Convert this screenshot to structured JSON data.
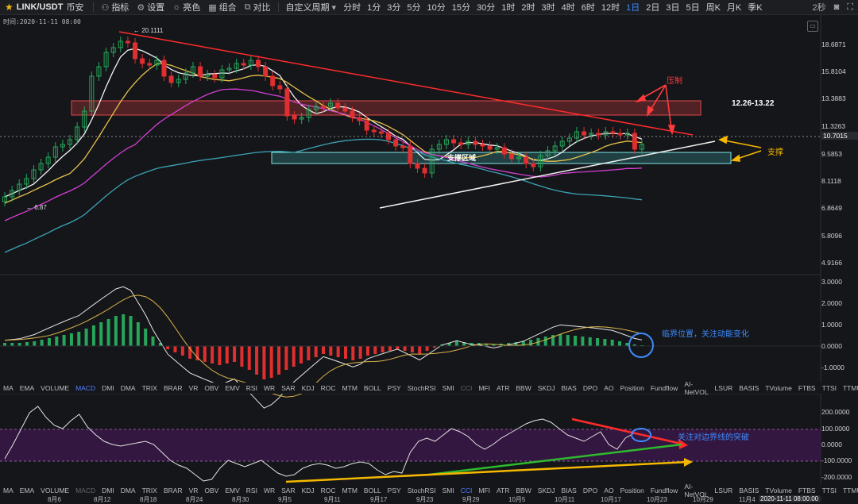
{
  "toolbar": {
    "symbol": "LINK/USDT",
    "exchange": "币安",
    "buttons": [
      {
        "icon": "indicator-icon",
        "label": "指标"
      },
      {
        "icon": "gear-icon",
        "label": "设置"
      },
      {
        "icon": "brightness-icon",
        "label": "亮色"
      },
      {
        "icon": "combine-icon",
        "label": "组合"
      },
      {
        "icon": "compare-icon",
        "label": "对比"
      }
    ],
    "custom_period": "自定义周期",
    "periods": [
      "分时",
      "1分",
      "3分",
      "5分",
      "10分",
      "15分",
      "30分",
      "1时",
      "2时",
      "3时",
      "4时",
      "6时",
      "12时",
      "1日",
      "2日",
      "3日",
      "5日",
      "周K",
      "月K",
      "季K"
    ],
    "active_period": "1日",
    "refresh": "2秒"
  },
  "time_label": "时间:2020-11-11 08:00",
  "main_chart": {
    "price_axis": [
      "18.6871",
      "15.8104",
      "13.3883",
      "11.3263",
      "9.5853",
      "8.1118",
      "6.8649",
      "5.8096",
      "4.9166"
    ],
    "current_price": "10.7015",
    "high_label": "← 20.1111",
    "low_label": "← 6.87",
    "zone_label_right": "12.26-13.22",
    "support_zone_label": "支撑区域",
    "resistance_note": "压制",
    "support_note": "支撑"
  },
  "macd_panel": {
    "axis": [
      "3.0000",
      "2.0000",
      "1.0000",
      "0.0000",
      "-1.0000"
    ],
    "note": "临界位置，关注动能变化"
  },
  "cci_panel": {
    "axis": [
      "200.0000",
      "100.0000",
      "0.0000",
      "-100.0000",
      "-200.0000"
    ],
    "note": "关注对边界线的突破"
  },
  "indicator_tabs": [
    "MA",
    "EMA",
    "VOLUME",
    "MACD",
    "DMI",
    "DMA",
    "TRIX",
    "BRAR",
    "VR",
    "OBV",
    "EMV",
    "RSI",
    "WR",
    "SAR",
    "KDJ",
    "ROC",
    "MTM",
    "BOLL",
    "PSY",
    "StochRSI",
    "SMI",
    "CCI",
    "MFI",
    "ATR",
    "BBW",
    "SKDJ",
    "BIAS",
    "DPO",
    "AO",
    "Position",
    "Fundflow",
    "AI-NetVOL",
    "LSUR",
    "BASIS",
    "TVolume",
    "FTBS",
    "TTSI",
    "TTMU"
  ],
  "indicator_tabs_row1_active": "MACD",
  "indicator_tabs_row2_active": "CCI",
  "date_axis": [
    "8月6",
    "8月12",
    "8月18",
    "8月24",
    "8月30",
    "9月5",
    "9月11",
    "9月17",
    "9月23",
    "9月29",
    "10月5",
    "10月11",
    "10月17",
    "10月23",
    "10月29",
    "11月4"
  ],
  "date_current": "2020-11-11 08:00:00",
  "colors": {
    "up": "#26a65b",
    "down": "#e02f2f",
    "accent": "#3d8bfd",
    "zone_red": "#c0393b",
    "zone_cyan": "#4fd6d6",
    "note_red": "#ff3b3b",
    "note_yellow": "#f5b800",
    "note_blue": "#3d8bfd"
  }
}
